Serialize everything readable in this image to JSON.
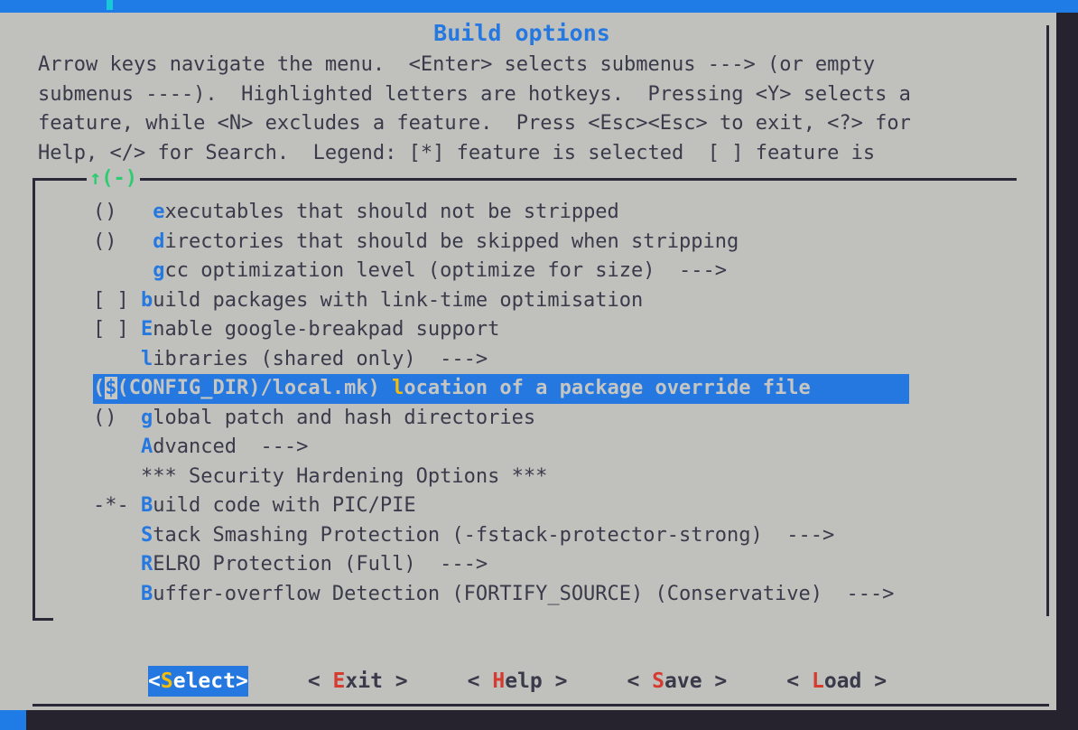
{
  "window": {
    "title": "Build options",
    "colors": {
      "background": "#c0c0bd",
      "terminal_background": "#26232f",
      "accent_blue": "#2478e0",
      "topbar_blue": "#1f7ce6",
      "cursor_cyan": "#19c8d8",
      "hotkey_blue": "#2478e0",
      "hotkey_red": "#d63b2f",
      "hotkey_yellow": "#f5bd0b",
      "scroll_green": "#2ecc71",
      "border": "#2b2838",
      "text": "#3a3a4a"
    }
  },
  "help_text": "Arrow keys navigate the menu.  <Enter> selects submenus ---> (or empty\nsubmenus ----).  Highlighted letters are hotkeys.  Pressing <Y> selects a\nfeature, while <N> excludes a feature.  Press <Esc><Esc> to exit, <?> for\nHelp, </> for Search.  Legend: [*] feature is selected  [ ] feature is",
  "list": {
    "scroll_indicator": "↑(-)",
    "items": [
      {
        "prefix": "()   ",
        "hotkey": "e",
        "label": "xecutables that should not be stripped",
        "selected": false
      },
      {
        "prefix": "()   ",
        "hotkey": "d",
        "label": "irectories that should be skipped when stripping",
        "selected": false
      },
      {
        "prefix": "     ",
        "hotkey": "g",
        "label": "cc optimization level (optimize for size)  --->",
        "selected": false
      },
      {
        "prefix": "[ ] ",
        "hotkey": "b",
        "label": "uild packages with link-time optimisation",
        "selected": false
      },
      {
        "prefix": "[ ] ",
        "hotkey": "E",
        "label": "nable google-breakpad support",
        "selected": false
      },
      {
        "prefix": "    ",
        "hotkey": "l",
        "label": "ibraries (shared only)  --->",
        "selected": false
      },
      {
        "prefix_pre": "(",
        "cursor_char": "$",
        "prefix_post": "(CONFIG_DIR)/local.mk) ",
        "hotkey": "l",
        "label": "ocation of a package override file",
        "selected": true
      },
      {
        "prefix": "()  ",
        "hotkey": "g",
        "label": "lobal patch and hash directories",
        "selected": false
      },
      {
        "prefix": "    ",
        "hotkey": "A",
        "label": "dvanced  --->",
        "selected": false
      },
      {
        "prefix": "    ",
        "hotkey": "",
        "label": "*** Security Hardening Options ***",
        "selected": false
      },
      {
        "prefix": "-*- ",
        "hotkey": "B",
        "label": "uild code with PIC/PIE",
        "selected": false
      },
      {
        "prefix": "    ",
        "hotkey": "S",
        "label": "tack Smashing Protection (-fstack-protector-strong)  --->",
        "selected": false
      },
      {
        "prefix": "    ",
        "hotkey": "R",
        "label": "ELRO Protection (Full)  --->",
        "selected": false
      },
      {
        "prefix": "    ",
        "hotkey": "B",
        "label": "uffer-overflow Detection (FORTIFY_SOURCE) (Conservative)  --->",
        "selected": false
      }
    ]
  },
  "buttons": [
    {
      "open": "<",
      "pre": "",
      "hot": "S",
      "post": "elect",
      "close": ">",
      "active": true
    },
    {
      "open": "<",
      "pre": " ",
      "hot": "E",
      "post": "xit ",
      "close": ">",
      "active": false
    },
    {
      "open": "<",
      "pre": " ",
      "hot": "H",
      "post": "elp ",
      "close": ">",
      "active": false
    },
    {
      "open": "<",
      "pre": " ",
      "hot": "S",
      "post": "ave ",
      "close": ">",
      "active": false
    },
    {
      "open": "<",
      "pre": " ",
      "hot": "L",
      "post": "oad ",
      "close": ">",
      "active": false
    }
  ]
}
